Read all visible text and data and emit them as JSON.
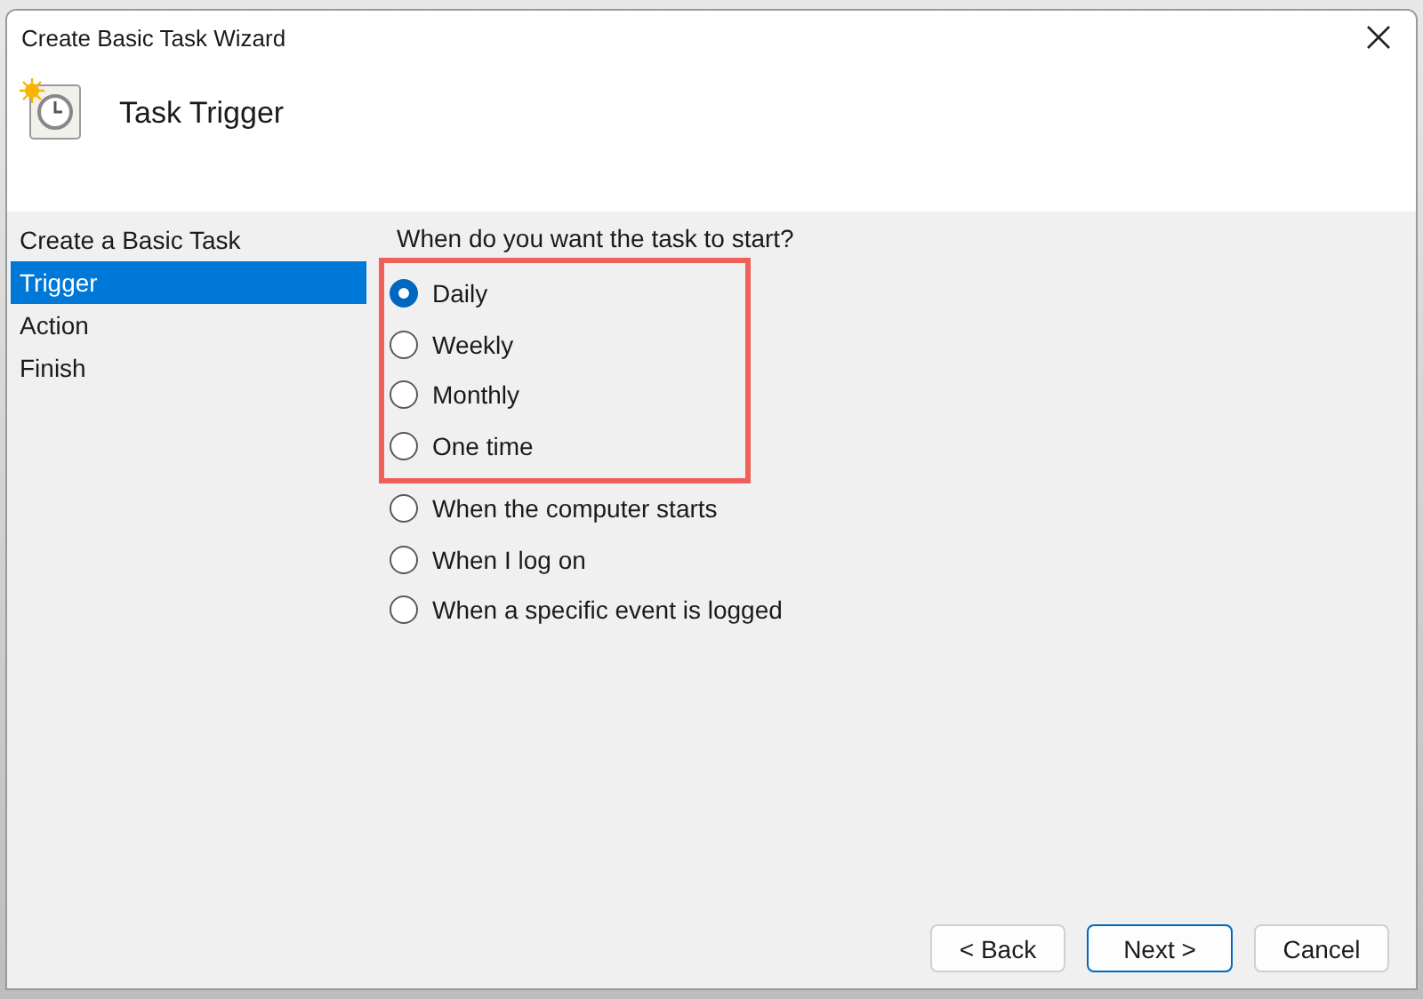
{
  "window": {
    "title": "Create Basic Task Wizard"
  },
  "header": {
    "title": "Task Trigger"
  },
  "steps": [
    {
      "label": "Create a Basic Task",
      "selected": false
    },
    {
      "label": "Trigger",
      "selected": true
    },
    {
      "label": "Action",
      "selected": false
    },
    {
      "label": "Finish",
      "selected": false
    }
  ],
  "question": "When do you want the task to start?",
  "options": [
    {
      "label": "Daily",
      "selected": true,
      "highlighted": true
    },
    {
      "label": "Weekly",
      "selected": false,
      "highlighted": true
    },
    {
      "label": "Monthly",
      "selected": false,
      "highlighted": true
    },
    {
      "label": "One time",
      "selected": false,
      "highlighted": true
    },
    {
      "label": "When the computer starts",
      "selected": false,
      "highlighted": false
    },
    {
      "label": "When I log on",
      "selected": false,
      "highlighted": false
    },
    {
      "label": "When a specific event is logged",
      "selected": false,
      "highlighted": false
    }
  ],
  "buttons": [
    {
      "label": "< Back",
      "default": false
    },
    {
      "label": "Next >",
      "default": true
    },
    {
      "label": "Cancel",
      "default": false
    }
  ]
}
